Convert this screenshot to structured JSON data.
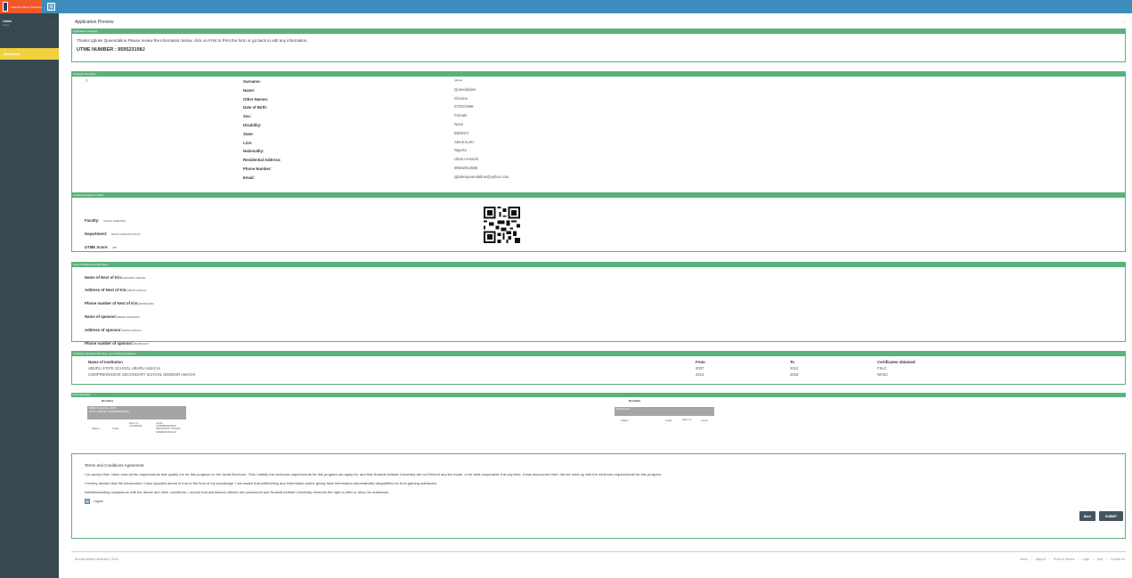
{
  "header": {
    "logo_text": "Nnamdi Azikiwe University",
    "menu_icon": "bars-icon"
  },
  "sidebar": {
    "user_name": "Linkin",
    "user_status": "Online",
    "items": [
      {
        "label": "Dashboard"
      }
    ]
  },
  "page": {
    "title": "Application Preview"
  },
  "completed": {
    "header": "Application completed",
    "message": "Thanks Igboke Queendaline Please review the information below, click on Print to Print the form or go back to edit any information.",
    "utme_label": "UTME NUMBER :",
    "utme_number": "959523198J"
  },
  "personal": {
    "header": "Personal information",
    "photo_placeholder": "3",
    "fields": [
      {
        "label": "Surname:",
        "value": "Igboke"
      },
      {
        "label": "Name:",
        "value": "Queendaline"
      },
      {
        "label": "Other Names:",
        "value": "Chioma"
      },
      {
        "label": "Date of Birth:",
        "value": "07/03/1998"
      },
      {
        "label": "Sex:",
        "value": "Female"
      },
      {
        "label": "Disability:",
        "value": "None"
      },
      {
        "label": "State:",
        "value": "EBONYI"
      },
      {
        "label": "LGA:",
        "value": "ABAKALIKI"
      },
      {
        "label": "Nationality:",
        "value": "Nigeria"
      },
      {
        "label": "Residential Address:",
        "value": "Uburu Amachi"
      },
      {
        "label": "Phone Number:",
        "value": "09032912556"
      },
      {
        "label": "Email:",
        "value": "igbokequeendaline@yahoo.com"
      }
    ]
  },
  "academic": {
    "header": "Academic program to Study",
    "faculty_label": "Faculty:",
    "faculty": "SOCIAL SCIENCES",
    "department_label": "Department:",
    "department": "MASS COMMUNICATION",
    "utme_label": "UTME Score:",
    "utme_score": "256"
  },
  "kin": {
    "header": "Next of Kin/Sponsor information",
    "fields": [
      {
        "label": "Name of Next of Kin:",
        "value": "INNOCENT IGBOKE"
      },
      {
        "label": "Address of Next of Kin:",
        "value": "UBURU AMACHI"
      },
      {
        "label": "Phone number of Next of Kin:",
        "value": "09032912966"
      },
      {
        "label": "Name of sponsor:",
        "value": "EBERE NWANKWO"
      },
      {
        "label": "Address of sponsor:",
        "value": "UBURU AMACHI"
      },
      {
        "label": "Phone number of sponsor:",
        "value": "08135510267"
      }
    ]
  },
  "institutions": {
    "header": "Institutions attended with dates, and certificates obtained",
    "columns": [
      "Name of Institution",
      "From",
      "To",
      "Certificates obtained"
    ],
    "rows": [
      [
        "UBURU STATE SCHOOL UBURU AMACHI",
        "2007",
        "2012",
        "FSLC"
      ],
      [
        "COMPREHENSIVE SECONDARY SCHOOL NDIEBOR AMACHI",
        "2013",
        "2018",
        "WAEC"
      ]
    ]
  },
  "olevel": {
    "header": "O'level Result(s)",
    "sitting1": {
      "title": "Result(1)",
      "line1": "WAEC     November, 2018",
      "line2": "Exam: 4080346 COMPREHENSIVE",
      "col_subject": "Subject",
      "col_grade": "Grade",
      "col_examno": "Exam no 4170990062",
      "col_centre": "Centre COMPREHENSIVE SECONDARY SCHOOL NDIEBOR AMACHI"
    },
    "sitting2": {
      "title": "Result(2)",
      "line1": "Examination",
      "col_subject": "Subject",
      "col_grade": "Grade",
      "col_examno": "Exam no",
      "col_centre": "Centre"
    }
  },
  "terms": {
    "title": "Terms and Conditions Agreement",
    "p1": "I do accept that I have read all the requirements that qualify me for this program on the Jamb Brochure. That I satisfy the minimum requirements for this program am apply for, and that Nnamdi Azikiwe University will not Refund any fee made, or be held responsible if at any time, it was discovered that I did not meet up with the minimum requirements for this program.",
    "p2": "I hereby declare that the information I have supplied above is true to the best of my knowledge. I am aware that withholding any information and/or giving false information automatically disqualifies me from gaining admission.",
    "p3": "Notwithstanding compliance with the above and other conditions, I accept that admissions offered are provisional and Nnamdi Azikiwe University reserves the right to offer or deny me admission.",
    "agree_label": "I Agree",
    "back_label": "Back",
    "submit_label": "SUBMIT"
  },
  "footer": {
    "copyright": "Nnamdi Azikiwe University © 2018",
    "links": [
      "About",
      "Support",
      "Terms of Service",
      "Login",
      "Help",
      "Contact Us"
    ]
  }
}
